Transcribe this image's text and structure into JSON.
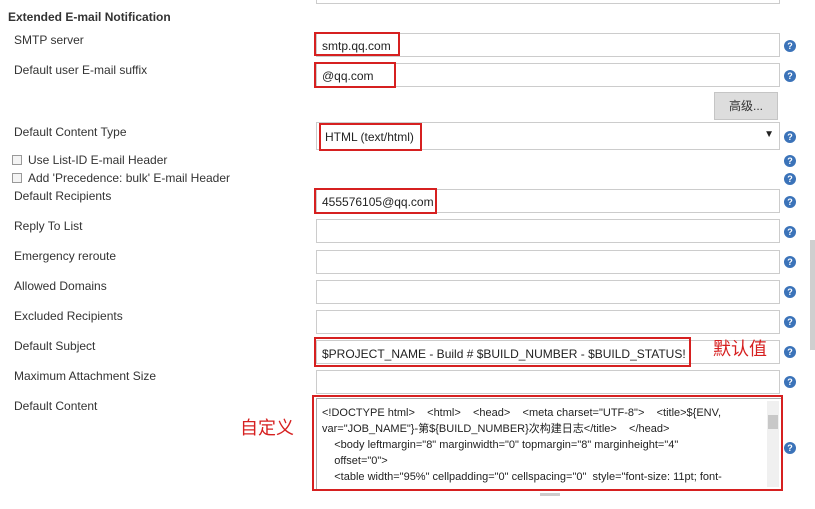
{
  "section": {
    "title": "Extended E-mail Notification"
  },
  "fields": {
    "smtp": {
      "label": "SMTP server",
      "value": "smtp.qq.com"
    },
    "suffix": {
      "label": "Default user E-mail suffix",
      "value": "@qq.com"
    },
    "advanced_button": "高级...",
    "content_type": {
      "label": "Default Content Type",
      "value": "HTML (text/html)"
    },
    "list_id": {
      "label": "Use List-ID E-mail Header"
    },
    "precedence": {
      "label": "Add 'Precedence: bulk' E-mail Header"
    },
    "recipients": {
      "label": "Default Recipients",
      "value": "455576105@qq.com"
    },
    "reply_to": {
      "label": "Reply To List",
      "value": ""
    },
    "emergency": {
      "label": "Emergency reroute",
      "value": ""
    },
    "allowed_domains": {
      "label": "Allowed Domains",
      "value": ""
    },
    "excluded": {
      "label": "Excluded Recipients",
      "value": ""
    },
    "subject": {
      "label": "Default Subject",
      "value": "$PROJECT_NAME - Build # $BUILD_NUMBER - $BUILD_STATUS!"
    },
    "max_attach": {
      "label": "Maximum Attachment Size",
      "value": ""
    },
    "content": {
      "label": "Default Content",
      "value": "<!DOCTYPE html>    <html>    <head>    <meta charset=\"UTF-8\">    <title>${ENV, var=\"JOB_NAME\"}-第${BUILD_NUMBER}次构建日志</title>    </head>\n    <body leftmargin=\"8\" marginwidth=\"0\" topmargin=\"8\" marginheight=\"4\"\n    offset=\"0\">\n    <table width=\"95%\" cellpadding=\"0\" cellspacing=\"0\"  style=\"font-size: 11pt; font-"
    }
  },
  "annotations": {
    "default_value": "默认值",
    "custom": "自定义"
  },
  "help_icon_glyph": "?",
  "dropdown_glyph": "▼",
  "colors": {
    "highlight": "#d62020",
    "help": "#3b73b9"
  }
}
